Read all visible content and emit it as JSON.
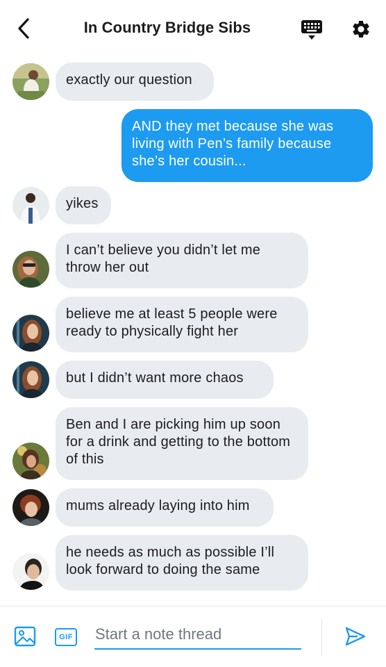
{
  "header": {
    "title": "In Country Bridge Sibs",
    "back_icon": "chevron-left-icon",
    "keyboard_icon": "keyboard-icon",
    "settings_icon": "gear-icon"
  },
  "messages": [
    {
      "direction": "in",
      "text": "exactly our question"
    },
    {
      "direction": "out",
      "text": "AND they met because she was living with Pen’s family because she’s her cousin..."
    },
    {
      "direction": "in",
      "text": "yikes"
    },
    {
      "direction": "in",
      "text": "I can’t believe you didn’t let me throw her out"
    },
    {
      "direction": "in",
      "text": "believe me at least 5 people were ready to physically fight her"
    },
    {
      "direction": "in",
      "text": "but I didn’t want more chaos"
    },
    {
      "direction": "in",
      "text": "Ben and I are picking him up soon for a drink and getting to the bottom of this"
    },
    {
      "direction": "in",
      "text": "mums already laying into him"
    },
    {
      "direction": "in",
      "text": "he needs as much as possible I’ll look forward to doing the same"
    }
  ],
  "composer": {
    "placeholder": "Start a note thread",
    "gif_label": "GIF",
    "image_icon": "image-icon",
    "send_icon": "send-icon"
  },
  "colors": {
    "accent": "#1d9bf0",
    "incoming_bubble": "#e8ebf0",
    "outgoing_text": "#ffffff"
  }
}
